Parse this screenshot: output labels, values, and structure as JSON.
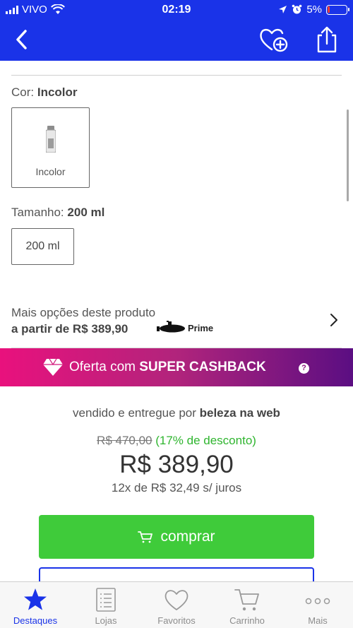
{
  "status_bar": {
    "carrier": "VIVO",
    "time": "02:19",
    "battery": "5%"
  },
  "product": {
    "color_label": "Cor:",
    "color_value": "Incolor",
    "color_options": [
      {
        "label": "Incolor",
        "selected": true
      }
    ],
    "size_label": "Tamanho:",
    "size_value": "200 ml",
    "size_options": [
      {
        "label": "200 ml",
        "selected": true
      }
    ]
  },
  "more_options": {
    "title": "Mais opções deste produto",
    "from_price": "a partir de R$ 389,90",
    "prime_label": "Prime"
  },
  "cashback": {
    "prefix": "Oferta com ",
    "highlight": "SUPER CASHBACK",
    "help_icon": "?"
  },
  "seller": {
    "prefix": "vendido e entregue por ",
    "name": "beleza na web"
  },
  "pricing": {
    "old_price": "R$ 470,00",
    "discount": "(17% de desconto)",
    "price": "R$ 389,90",
    "installments": "12x de R$ 32,49 s/ juros"
  },
  "buy_button": {
    "label": "comprar"
  },
  "tab_bar": {
    "items": [
      {
        "label": "Destaques",
        "icon": "star-icon",
        "active": true
      },
      {
        "label": "Lojas",
        "icon": "list-icon",
        "active": false
      },
      {
        "label": "Favoritos",
        "icon": "heart-icon",
        "active": false
      },
      {
        "label": "Carrinho",
        "icon": "cart-icon",
        "active": false
      },
      {
        "label": "Mais",
        "icon": "more-icon",
        "active": false
      }
    ]
  },
  "colors": {
    "brand_blue": "#1a33e8",
    "buy_green": "#3fcb3a",
    "discount_green": "#2fb52f",
    "cashback_start": "#e9117d",
    "cashback_end": "#5b0e82"
  }
}
